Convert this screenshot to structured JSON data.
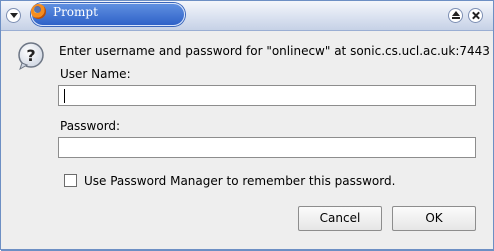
{
  "window": {
    "title": "Prompt"
  },
  "dialog": {
    "message": "Enter username and password for \"onlinecw\" at sonic.cs.ucl.ac.uk:7443",
    "username_label": "User Name:",
    "username_value": "",
    "password_label": "Password:",
    "password_value": "",
    "remember_label": "Use Password Manager to remember this password.",
    "remember_checked": false,
    "cancel_label": "Cancel",
    "ok_label": "OK"
  },
  "icons": {
    "window_menu": "chevron-down-icon",
    "app": "firefox-icon",
    "maximize": "maximize-icon",
    "close": "close-icon",
    "question": "question-icon"
  },
  "colors": {
    "title_tab": "#3d6fd0",
    "window_border": "#6d8fc4",
    "dialog_bg": "#eeeeee"
  }
}
